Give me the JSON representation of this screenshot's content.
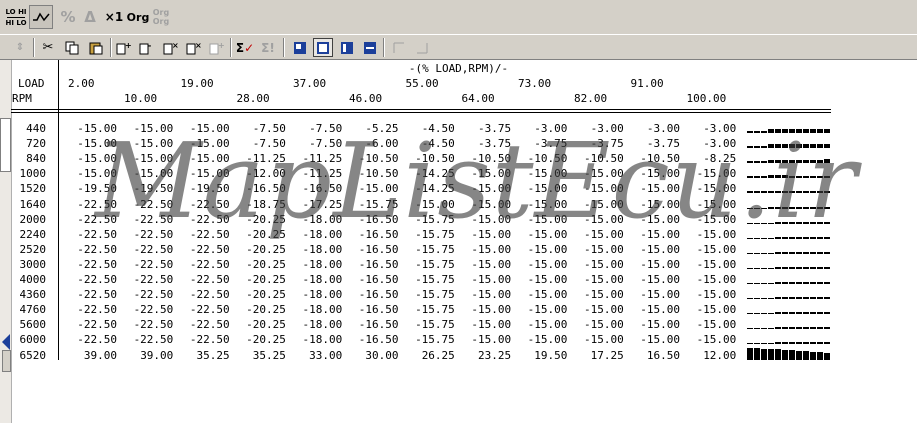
{
  "toolbar_top": {
    "lohi_label": "LO HI",
    "hilo_label": "HI LO",
    "percent_label": "%",
    "delta_label": "Δ",
    "x1_label": "×1",
    "org_label": "Org",
    "org_stack_label": "Org Org"
  },
  "table": {
    "title": "-(% LOAD,RPM)/-",
    "load_label": "LOAD",
    "rpm_label": "RPM",
    "load_odd": [
      "2.00",
      "19.00",
      "37.00",
      "55.00",
      "73.00",
      "91.00"
    ],
    "load_even": [
      "10.00",
      "28.00",
      "46.00",
      "64.00",
      "82.00",
      "100.00"
    ],
    "rows": [
      {
        "rpm": "440",
        "values": [
          "-15.00",
          "-15.00",
          "-15.00",
          "-7.50",
          "-7.50",
          "-5.25",
          "-4.50",
          "-3.75",
          "-3.00",
          "-3.00",
          "-3.00",
          "-3.00"
        ]
      },
      {
        "rpm": "720",
        "values": [
          "-15.00",
          "-15.00",
          "-15.00",
          "-7.50",
          "-7.50",
          "-6.00",
          "-4.50",
          "-3.75",
          "-3.75",
          "-3.75",
          "-3.75",
          "-3.00"
        ]
      },
      {
        "rpm": "840",
        "values": [
          "-15.00",
          "-15.00",
          "-15.00",
          "-11.25",
          "-11.25",
          "-10.50",
          "-10.50",
          "-10.50",
          "-10.50",
          "-10.50",
          "-10.50",
          "-8.25"
        ]
      },
      {
        "rpm": "1000",
        "values": [
          "-15.00",
          "-15.00",
          "-15.00",
          "-12.00",
          "-11.25",
          "-10.50",
          "-14.25",
          "-15.00",
          "-15.00",
          "-15.00",
          "-15.00",
          "-15.00"
        ]
      },
      {
        "rpm": "1520",
        "values": [
          "-19.50",
          "-19.50",
          "-19.50",
          "-16.50",
          "-16.50",
          "-15.00",
          "-14.25",
          "-15.00",
          "-15.00",
          "-15.00",
          "-15.00",
          "-15.00"
        ]
      },
      {
        "rpm": "1640",
        "values": [
          "-22.50",
          "-22.50",
          "-22.50",
          "-18.75",
          "-17.25",
          "-15.75",
          "-15.00",
          "-15.00",
          "-15.00",
          "-15.00",
          "-15.00",
          "-15.00"
        ]
      },
      {
        "rpm": "2000",
        "values": [
          "-22.50",
          "-22.50",
          "-22.50",
          "-20.25",
          "-18.00",
          "-16.50",
          "-15.75",
          "-15.00",
          "-15.00",
          "-15.00",
          "-15.00",
          "-15.00"
        ]
      },
      {
        "rpm": "2240",
        "values": [
          "-22.50",
          "-22.50",
          "-22.50",
          "-20.25",
          "-18.00",
          "-16.50",
          "-15.75",
          "-15.00",
          "-15.00",
          "-15.00",
          "-15.00",
          "-15.00"
        ]
      },
      {
        "rpm": "2520",
        "values": [
          "-22.50",
          "-22.50",
          "-22.50",
          "-20.25",
          "-18.00",
          "-16.50",
          "-15.75",
          "-15.00",
          "-15.00",
          "-15.00",
          "-15.00",
          "-15.00"
        ]
      },
      {
        "rpm": "3000",
        "values": [
          "-22.50",
          "-22.50",
          "-22.50",
          "-20.25",
          "-18.00",
          "-16.50",
          "-15.75",
          "-15.00",
          "-15.00",
          "-15.00",
          "-15.00",
          "-15.00"
        ]
      },
      {
        "rpm": "4000",
        "values": [
          "-22.50",
          "-22.50",
          "-22.50",
          "-20.25",
          "-18.00",
          "-16.50",
          "-15.75",
          "-15.00",
          "-15.00",
          "-15.00",
          "-15.00",
          "-15.00"
        ]
      },
      {
        "rpm": "4360",
        "values": [
          "-22.50",
          "-22.50",
          "-22.50",
          "-20.25",
          "-18.00",
          "-16.50",
          "-15.75",
          "-15.00",
          "-15.00",
          "-15.00",
          "-15.00",
          "-15.00"
        ]
      },
      {
        "rpm": "4760",
        "values": [
          "-22.50",
          "-22.50",
          "-22.50",
          "-20.25",
          "-18.00",
          "-16.50",
          "-15.75",
          "-15.00",
          "-15.00",
          "-15.00",
          "-15.00",
          "-15.00"
        ]
      },
      {
        "rpm": "5600",
        "values": [
          "-22.50",
          "-22.50",
          "-22.50",
          "-20.25",
          "-18.00",
          "-16.50",
          "-15.75",
          "-15.00",
          "-15.00",
          "-15.00",
          "-15.00",
          "-15.00"
        ]
      },
      {
        "rpm": "6000",
        "values": [
          "-22.50",
          "-22.50",
          "-22.50",
          "-20.25",
          "-18.00",
          "-16.50",
          "-15.75",
          "-15.00",
          "-15.00",
          "-15.00",
          "-15.00",
          "-15.00"
        ]
      },
      {
        "rpm": "6520",
        "values": [
          "39.00",
          "39.00",
          "35.25",
          "35.25",
          "33.00",
          "30.00",
          "26.25",
          "23.25",
          "19.50",
          "17.25",
          "16.50",
          "12.00"
        ]
      }
    ]
  },
  "watermark": "MapListEcu.ir",
  "colors": {
    "toolbar": "#d4d0c8",
    "accent": "#1c3f9a"
  }
}
